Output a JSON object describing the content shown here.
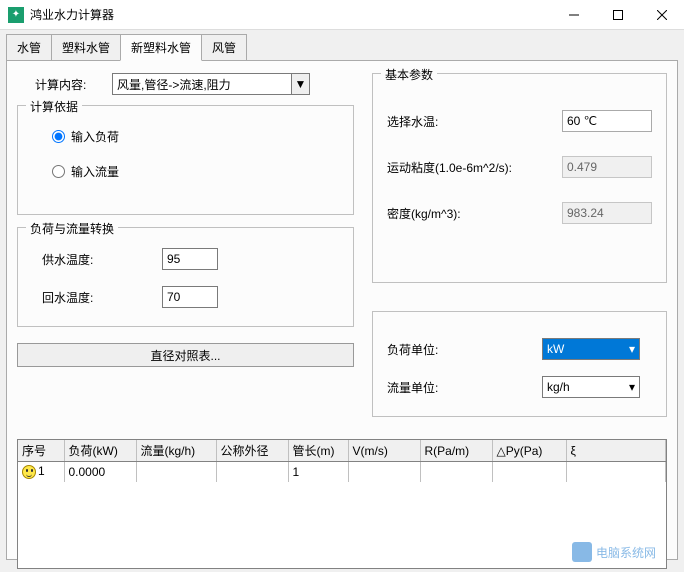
{
  "window": {
    "title": "鸿业水力计算器"
  },
  "tabs": {
    "items": [
      "水管",
      "塑料水管",
      "新塑料水管",
      "风管"
    ],
    "active": 2
  },
  "calc": {
    "label": "计算内容:",
    "value": "风量,管径->流速,阻力"
  },
  "basis": {
    "legend": "计算依据",
    "radio1": "输入负荷",
    "radio2": "输入流量"
  },
  "basic_params": {
    "legend": "基本参数",
    "temp_label": "选择水温:",
    "temp_value": "60 ℃",
    "visc_label": "运动粘度(1.0e-6m^2/s):",
    "visc_value": "0.479",
    "dens_label": "密度(kg/m^3):",
    "dens_value": "983.24"
  },
  "conversion": {
    "legend": "负荷与流量转换",
    "supply_label": "供水温度:",
    "supply_value": "95",
    "return_label": "回水温度:",
    "return_value": "70"
  },
  "units": {
    "load_label": "负荷单位:",
    "load_value": "kW",
    "flow_label": "流量单位:",
    "flow_value": "kg/h"
  },
  "lookup_btn": "直径对照表...",
  "table": {
    "headers": [
      "序号",
      "负荷(kW)",
      "流量(kg/h)",
      "公称外径",
      "管长(m)",
      "V(m/s)",
      "R(Pa/m)",
      "△Py(Pa)",
      "ξ"
    ],
    "row1": {
      "seq": "1",
      "load": "0.0000",
      "len": "1"
    }
  },
  "watermark": "电脑系统网"
}
